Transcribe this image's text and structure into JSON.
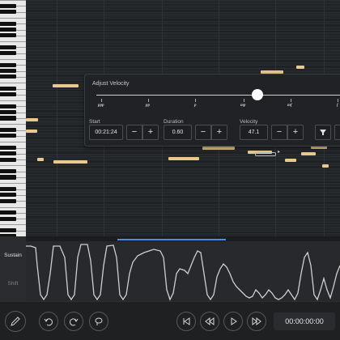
{
  "velocity_popup": {
    "title": "Adjust Velocity",
    "slider_value": 47.1,
    "dynamics": [
      "ppp",
      "pp",
      "p",
      "mp",
      "mf",
      "f"
    ],
    "start": {
      "label": "Start",
      "value": "00:21:24"
    },
    "duration": {
      "label": "Duration",
      "value": "0.60"
    },
    "velocity": {
      "label": "Velocity",
      "value": "47.1"
    },
    "minus_label": "−",
    "plus_label": "+"
  },
  "lanes": {
    "sustain_label": "Sustain",
    "shift_label": "Shift"
  },
  "transport": {
    "time": "00:00:00:00"
  },
  "colors": {
    "note": "#e9c98d",
    "playhead": "#4b8de8",
    "background": "#1b1c1e"
  },
  "icons": [
    "pencil-icon",
    "undo-icon",
    "redo-icon",
    "lasso-icon",
    "skip-back-icon",
    "rewind-icon",
    "play-icon",
    "fast-forward-icon",
    "filter-icon"
  ]
}
